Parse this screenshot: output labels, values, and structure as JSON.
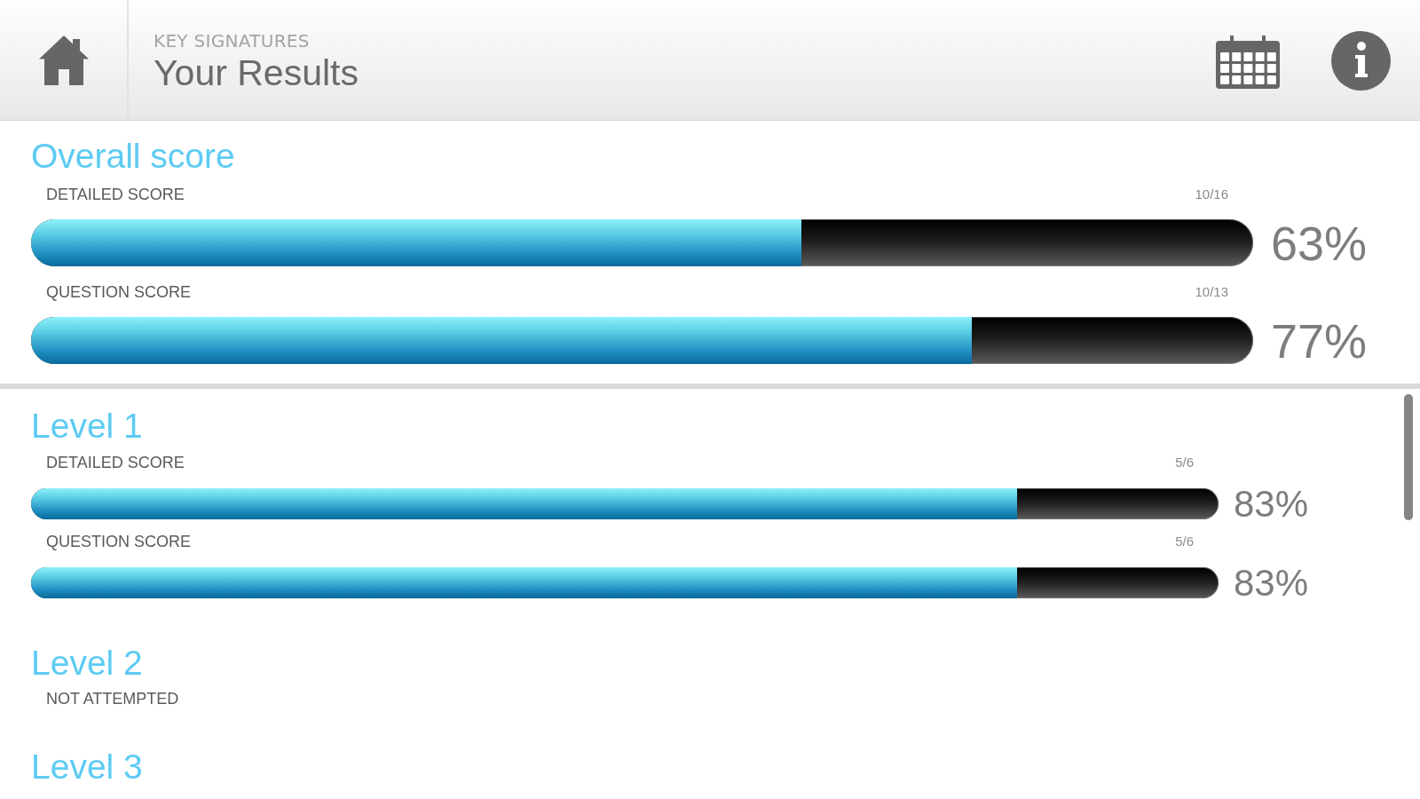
{
  "header": {
    "subtitle": "KEY SIGNATURES",
    "title": "Your Results"
  },
  "overall": {
    "title": "Overall score",
    "scores": [
      {
        "label": "DETAILED SCORE",
        "fraction": "10/16",
        "level": 0.63,
        "reading": "63%"
      },
      {
        "label": "QUESTION SCORE",
        "fraction": "10/13",
        "level": 0.77,
        "reading": "77%"
      }
    ]
  },
  "levels": [
    {
      "title": "Level 1",
      "kind": "scored",
      "scores": [
        {
          "label": "DETAILED SCORE",
          "fraction": "5/6",
          "level": 0.83,
          "reading": "83%"
        },
        {
          "label": "QUESTION SCORE",
          "fraction": "5/6",
          "level": 0.83,
          "reading": "83%"
        }
      ]
    },
    {
      "title": "Level 2",
      "kind": "status",
      "status": "NOT ATTEMPTED"
    },
    {
      "title": "Level 3",
      "kind": "status"
    }
  ]
}
